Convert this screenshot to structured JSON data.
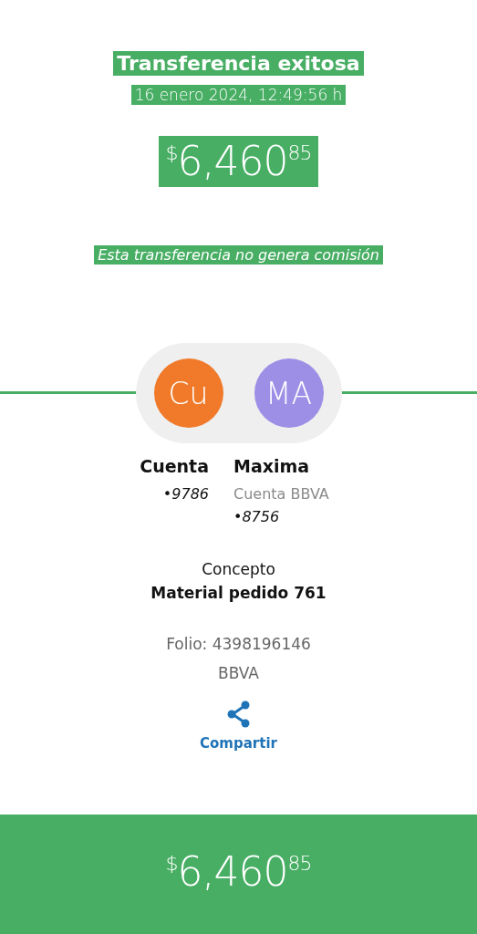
{
  "header": {
    "title": "Transferencia exitosa",
    "datetime": "16 enero 2024, 12:49:56 h",
    "amount": {
      "currency": "$",
      "whole": "6,460",
      "cents": "85"
    },
    "note": "Esta transferencia no genera comisión"
  },
  "parties": [
    {
      "initials": "Cu",
      "color": "#f07a2a",
      "name": "Cuenta",
      "lines": [
        {
          "kind": "account",
          "text": "•9786"
        }
      ]
    },
    {
      "initials": "MA",
      "color": "#9d8ee6",
      "name": "Maxima",
      "lines": [
        {
          "kind": "bank",
          "text": "Cuenta BBVA"
        },
        {
          "kind": "account",
          "text": "•8756"
        }
      ]
    }
  ],
  "concept": {
    "label": "Concepto",
    "value": "Material pedido 761"
  },
  "folio": "Folio: 4398196146",
  "bank": "BBVA",
  "share": {
    "label": "Compartir"
  },
  "footer": {
    "amount": {
      "currency": "$",
      "whole": "6,460",
      "cents": "85"
    }
  }
}
